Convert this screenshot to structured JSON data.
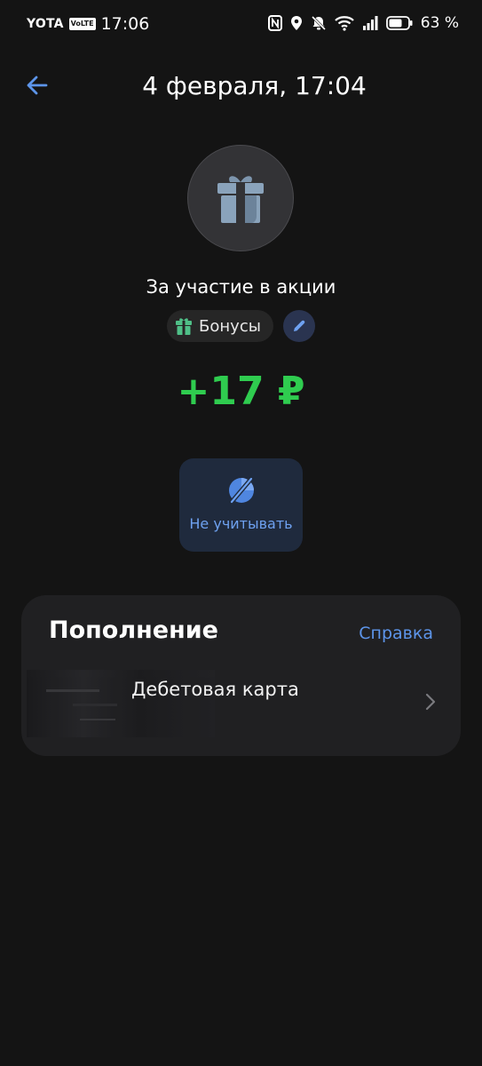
{
  "status_bar": {
    "carrier": "YOTA",
    "volte": "VoLTE",
    "time": "17:06",
    "battery_percent": "63 %",
    "icons": [
      "nfc-icon",
      "location-icon",
      "bell-off-icon",
      "wifi-icon",
      "signal-icon",
      "battery-icon"
    ]
  },
  "header": {
    "title": "4 февраля, 17:04",
    "back_icon": "arrow-left-icon"
  },
  "operation": {
    "icon": "gift-icon",
    "name": "За участие в акции",
    "category": "Бонусы",
    "category_icon": "gift-icon",
    "edit_icon": "pencil-icon",
    "amount": "+17 ₽"
  },
  "actions": {
    "exclude_label": "Не учитывать",
    "exclude_icon": "pie-slash-icon"
  },
  "details": {
    "title": "Пополнение",
    "help_label": "Справка",
    "account_name": "Дебетовая карта",
    "account_sub": "",
    "chevron_icon": "chevron-right-icon"
  },
  "colors": {
    "background": "#141414",
    "amount_positive": "#2fcc4f",
    "accent_blue": "#5d95ea",
    "card_background": "#202022"
  }
}
